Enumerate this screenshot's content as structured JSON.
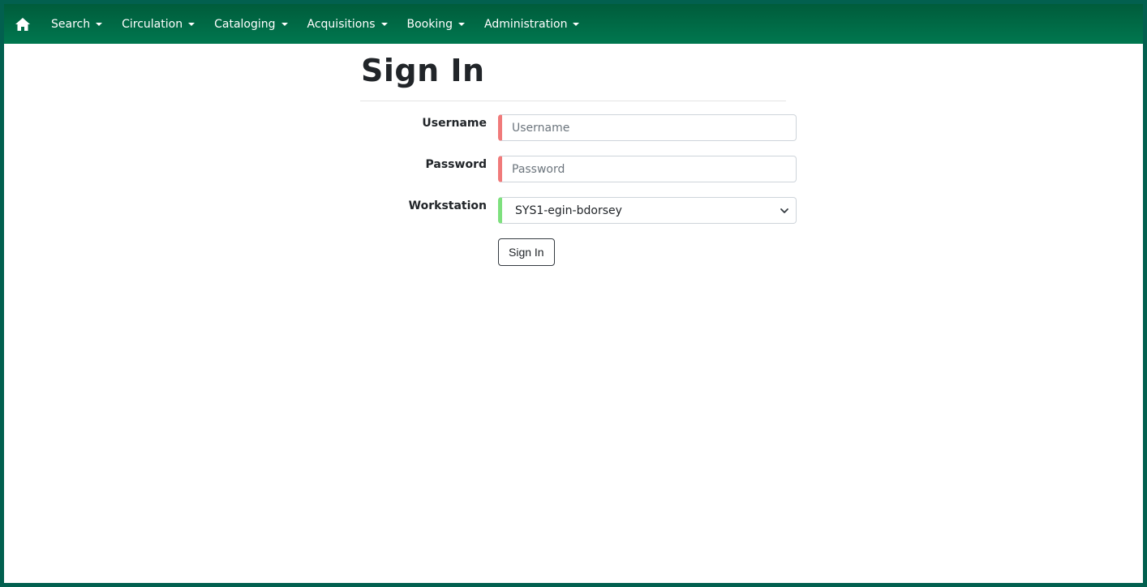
{
  "navbar": {
    "home_icon": "home-icon",
    "items": [
      {
        "label": "Search"
      },
      {
        "label": "Circulation"
      },
      {
        "label": "Cataloging"
      },
      {
        "label": "Acquisitions"
      },
      {
        "label": "Booking"
      },
      {
        "label": "Administration"
      }
    ]
  },
  "signin": {
    "title": "Sign In",
    "username": {
      "label": "Username",
      "placeholder": "Username",
      "value": ""
    },
    "password": {
      "label": "Password",
      "placeholder": "Password",
      "value": ""
    },
    "workstation": {
      "label": "Workstation",
      "selected": "SYS1-egin-bdorsey"
    },
    "submit_label": "Sign In"
  },
  "colors": {
    "navbar_top": "#005c3b",
    "navbar_bottom": "#00774f",
    "frame": "#02604f",
    "required_marker": "#f07a7a",
    "valid_marker": "#7ee07e"
  }
}
